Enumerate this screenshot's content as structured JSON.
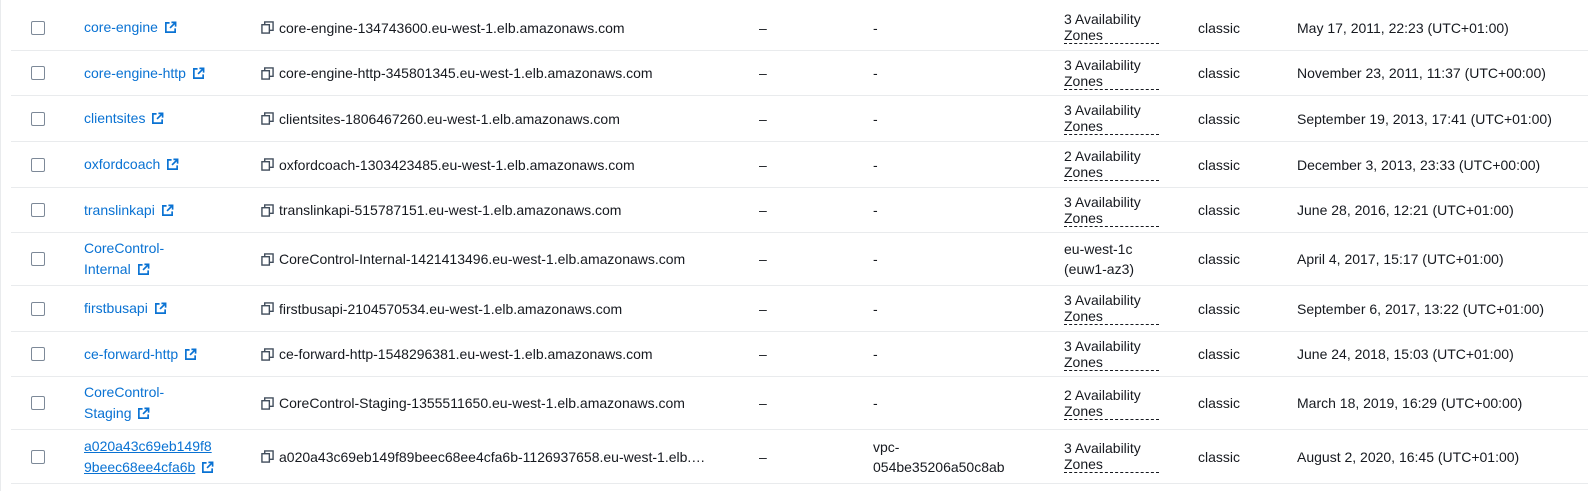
{
  "rows": [
    {
      "name_line1": "core-engine",
      "name_line2": "",
      "dns": "core-engine-134743600.eu-west-1.elb.amazonaws.com",
      "state": "–",
      "vpc_line1": "-",
      "vpc_line2": "",
      "az_line1": "3 Availability",
      "az_line2": "Zones",
      "type": "classic",
      "date": "May 17, 2011, 22:23 (UTC+01:00)"
    },
    {
      "name_line1": "core-engine-http",
      "name_line2": "",
      "dns": "core-engine-http-345801345.eu-west-1.elb.amazonaws.com",
      "state": "–",
      "vpc_line1": "-",
      "vpc_line2": "",
      "az_line1": "3 Availability",
      "az_line2": "Zones",
      "type": "classic",
      "date": "November 23, 2011, 11:37 (UTC+00:00)"
    },
    {
      "name_line1": "clientsites",
      "name_line2": "",
      "dns": "clientsites-1806467260.eu-west-1.elb.amazonaws.com",
      "state": "–",
      "vpc_line1": "-",
      "vpc_line2": "",
      "az_line1": "3 Availability",
      "az_line2": "Zones",
      "type": "classic",
      "date": "September 19, 2013, 17:41 (UTC+01:00)"
    },
    {
      "name_line1": "oxfordcoach",
      "name_line2": "",
      "dns": "oxfordcoach-1303423485.eu-west-1.elb.amazonaws.com",
      "state": "–",
      "vpc_line1": "-",
      "vpc_line2": "",
      "az_line1": "2 Availability",
      "az_line2": "Zones",
      "type": "classic",
      "date": "December 3, 2013, 23:33 (UTC+00:00)"
    },
    {
      "name_line1": "translinkapi",
      "name_line2": "",
      "dns": "translinkapi-515787151.eu-west-1.elb.amazonaws.com",
      "state": "–",
      "vpc_line1": "-",
      "vpc_line2": "",
      "az_line1": "3 Availability",
      "az_line2": "Zones",
      "type": "classic",
      "date": "June 28, 2016, 12:21 (UTC+01:00)"
    },
    {
      "name_line1": "CoreControl-",
      "name_line2": "Internal",
      "dns": "CoreControl-Internal-1421413496.eu-west-1.elb.amazonaws.com",
      "state": "–",
      "vpc_line1": "-",
      "vpc_line2": "",
      "az_line1": "eu-west-1c",
      "az_line2": "(euw1-az3)",
      "type": "classic",
      "date": "April 4, 2017, 15:17 (UTC+01:00)"
    },
    {
      "name_line1": "firstbusapi",
      "name_line2": "",
      "dns": "firstbusapi-2104570534.eu-west-1.elb.amazonaws.com",
      "state": "–",
      "vpc_line1": "-",
      "vpc_line2": "",
      "az_line1": "3 Availability",
      "az_line2": "Zones",
      "type": "classic",
      "date": "September 6, 2017, 13:22 (UTC+01:00)"
    },
    {
      "name_line1": "ce-forward-http",
      "name_line2": "",
      "dns": "ce-forward-http-1548296381.eu-west-1.elb.amazonaws.com",
      "state": "–",
      "vpc_line1": "-",
      "vpc_line2": "",
      "az_line1": "3 Availability",
      "az_line2": "Zones",
      "type": "classic",
      "date": "June 24, 2018, 15:03 (UTC+01:00)"
    },
    {
      "name_line1": "CoreControl-",
      "name_line2": "Staging",
      "dns": "CoreControl-Staging-1355511650.eu-west-1.elb.amazonaws.com",
      "state": "–",
      "vpc_line1": "-",
      "vpc_line2": "",
      "az_line1": "2 Availability",
      "az_line2": "Zones",
      "type": "classic",
      "date": "March 18, 2019, 16:29 (UTC+00:00)"
    },
    {
      "name_line1": "a020a43c69eb149f8",
      "name_line2": "9beec68ee4cfa6b",
      "dns": "a020a43c69eb149f89beec68ee4cfa6b-1126937658.eu-west-1.elb.…",
      "state": "–",
      "vpc_line1": "vpc-",
      "vpc_line2": "054be35206a50c8ab",
      "az_line1": "3 Availability",
      "az_line2": "Zones",
      "type": "classic",
      "date": "August 2, 2020, 16:45 (UTC+01:00)"
    }
  ],
  "colors": {
    "link": "#0972d3",
    "text": "#16191f",
    "divider": "#e9ebed"
  },
  "icons": {
    "external": "external-link-icon",
    "copy": "copy-icon"
  }
}
